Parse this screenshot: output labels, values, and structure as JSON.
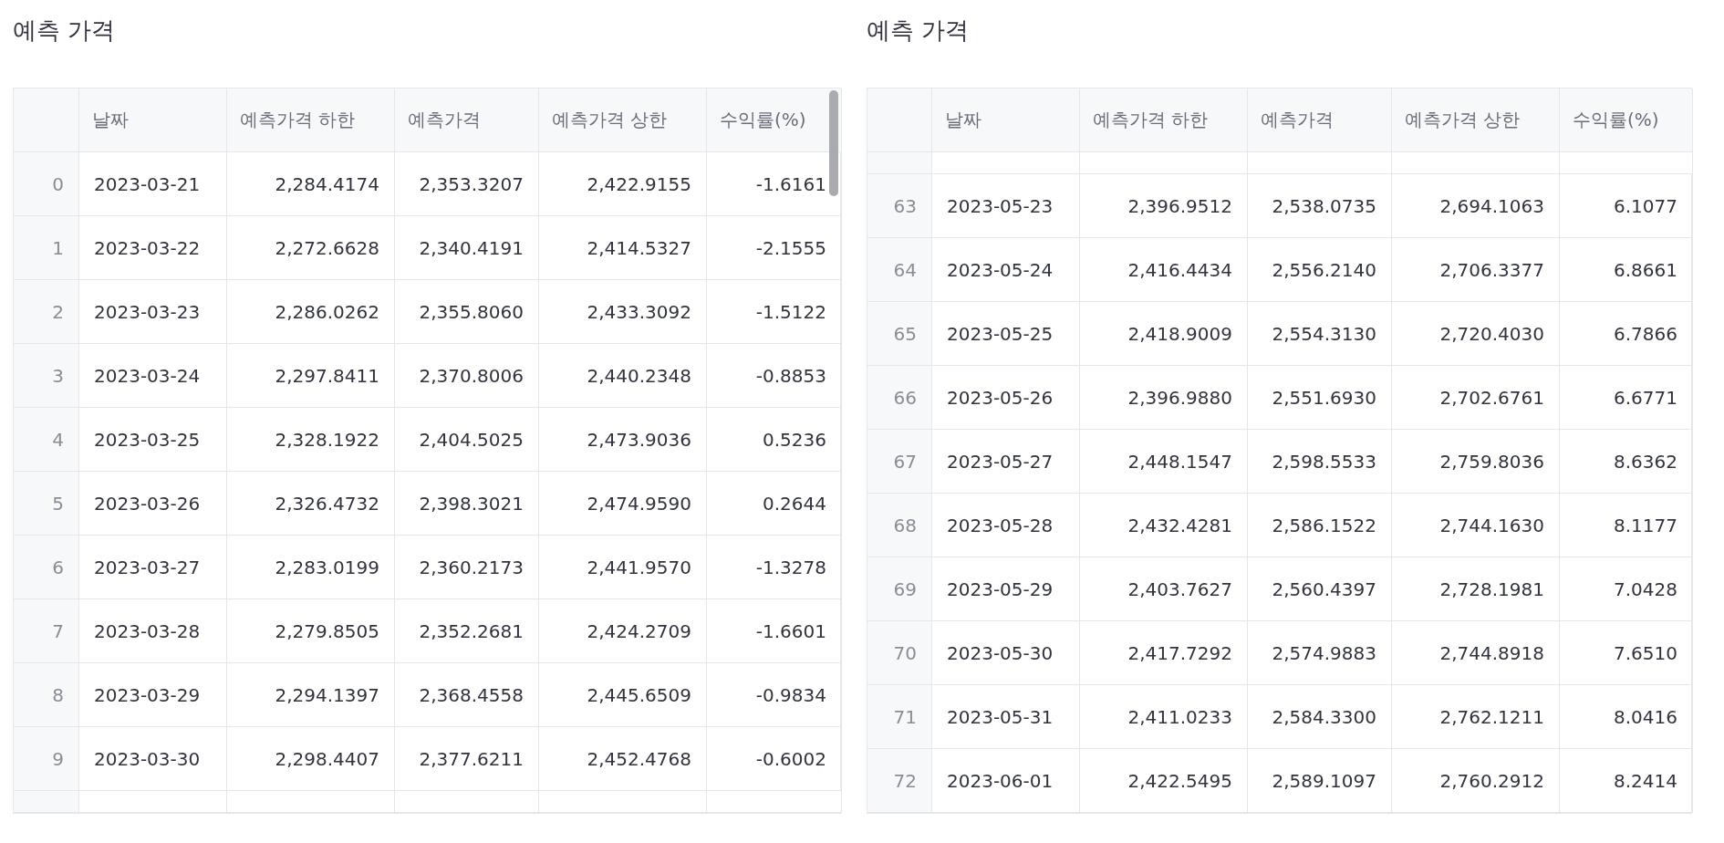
{
  "panels": [
    {
      "title": "예측 가격",
      "scrollbar": true,
      "partial_top": false,
      "partial_bottom": true,
      "columns": [
        "",
        "날짜",
        "예측가격 하한",
        "예측가격",
        "예측가격 상한",
        "수익률(%)"
      ],
      "rows": [
        [
          "0",
          "2023-03-21",
          "2,284.4174",
          "2,353.3207",
          "2,422.9155",
          "-1.6161"
        ],
        [
          "1",
          "2023-03-22",
          "2,272.6628",
          "2,340.4191",
          "2,414.5327",
          "-2.1555"
        ],
        [
          "2",
          "2023-03-23",
          "2,286.0262",
          "2,355.8060",
          "2,433.3092",
          "-1.5122"
        ],
        [
          "3",
          "2023-03-24",
          "2,297.8411",
          "2,370.8006",
          "2,440.2348",
          "-0.8853"
        ],
        [
          "4",
          "2023-03-25",
          "2,328.1922",
          "2,404.5025",
          "2,473.9036",
          "0.5236"
        ],
        [
          "5",
          "2023-03-26",
          "2,326.4732",
          "2,398.3021",
          "2,474.9590",
          "0.2644"
        ],
        [
          "6",
          "2023-03-27",
          "2,283.0199",
          "2,360.2173",
          "2,441.9570",
          "-1.3278"
        ],
        [
          "7",
          "2023-03-28",
          "2,279.8505",
          "2,352.2681",
          "2,424.2709",
          "-1.6601"
        ],
        [
          "8",
          "2023-03-29",
          "2,294.1397",
          "2,368.4558",
          "2,445.6509",
          "-0.9834"
        ],
        [
          "9",
          "2023-03-30",
          "2,298.4407",
          "2,377.6211",
          "2,452.4768",
          "-0.6002"
        ]
      ]
    },
    {
      "title": "예측 가격",
      "scrollbar": false,
      "partial_top": true,
      "partial_bottom": false,
      "columns": [
        "",
        "날짜",
        "예측가격 하한",
        "예측가격",
        "예측가격 상한",
        "수익률(%)"
      ],
      "rows": [
        [
          "63",
          "2023-05-23",
          "2,396.9512",
          "2,538.0735",
          "2,694.1063",
          "6.1077"
        ],
        [
          "64",
          "2023-05-24",
          "2,416.4434",
          "2,556.2140",
          "2,706.3377",
          "6.8661"
        ],
        [
          "65",
          "2023-05-25",
          "2,418.9009",
          "2,554.3130",
          "2,720.4030",
          "6.7866"
        ],
        [
          "66",
          "2023-05-26",
          "2,396.9880",
          "2,551.6930",
          "2,702.6761",
          "6.6771"
        ],
        [
          "67",
          "2023-05-27",
          "2,448.1547",
          "2,598.5533",
          "2,759.8036",
          "8.6362"
        ],
        [
          "68",
          "2023-05-28",
          "2,432.4281",
          "2,586.1522",
          "2,744.1630",
          "8.1177"
        ],
        [
          "69",
          "2023-05-29",
          "2,403.7627",
          "2,560.4397",
          "2,728.1981",
          "7.0428"
        ],
        [
          "70",
          "2023-05-30",
          "2,417.7292",
          "2,574.9883",
          "2,744.8918",
          "7.6510"
        ],
        [
          "71",
          "2023-05-31",
          "2,411.0233",
          "2,584.3300",
          "2,762.1211",
          "8.0416"
        ],
        [
          "72",
          "2023-06-01",
          "2,422.5495",
          "2,589.1097",
          "2,760.2912",
          "8.2414"
        ]
      ]
    }
  ]
}
